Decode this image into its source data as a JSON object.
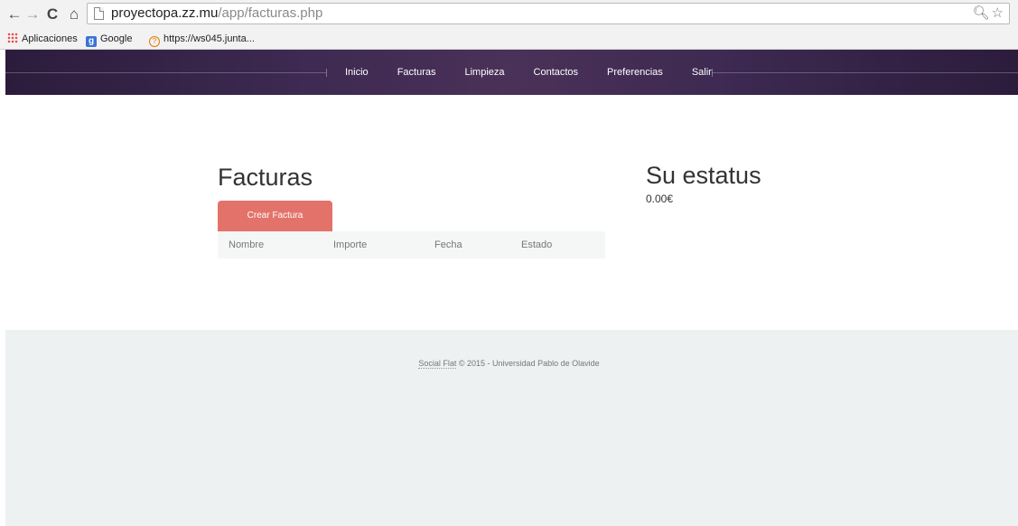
{
  "browser": {
    "url_host": "proyectopa.zz.mu",
    "url_path": "/app/facturas.php",
    "bookmarks": [
      {
        "label": "Aplicaciones"
      },
      {
        "label": "Google"
      },
      {
        "label": "https://ws045.junta..."
      }
    ]
  },
  "nav": {
    "items": [
      "Inicio",
      "Facturas",
      "Limpieza",
      "Contactos",
      "Preferencias",
      "Salir"
    ]
  },
  "main": {
    "title": "Facturas",
    "create_button": "Crear Factura",
    "table_headers": [
      "Nombre",
      "Importe",
      "Fecha",
      "Estado"
    ]
  },
  "status": {
    "title": "Su estatus",
    "value": "0.00€"
  },
  "footer": {
    "brand": "Social Flat",
    "copyright": " © 2015 - ",
    "university": "Universidad Pablo de Olavide"
  }
}
